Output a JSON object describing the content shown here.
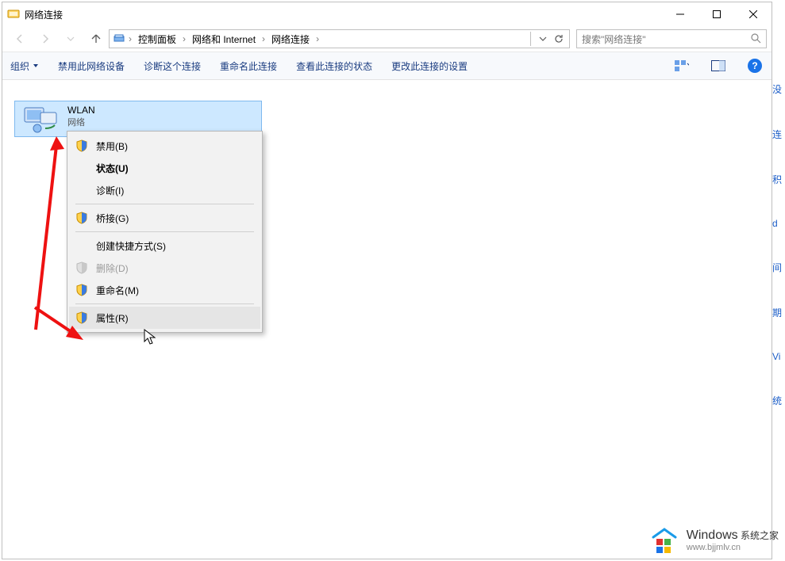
{
  "titlebar": {
    "title": "网络连接"
  },
  "breadcrumbs": {
    "b0": "控制面板",
    "b1": "网络和 Internet",
    "b2": "网络连接"
  },
  "search": {
    "placeholder": "搜索\"网络连接\""
  },
  "toolbar": {
    "org_label": "组织",
    "t1": "禁用此网络设备",
    "t2": "诊断这个连接",
    "t3": "重命名此连接",
    "t4": "查看此连接的状态",
    "t5": "更改此连接的设置"
  },
  "adapter": {
    "name": "WLAN",
    "sub": "网络"
  },
  "ctx": {
    "disable": "禁用(B)",
    "status": "状态(U)",
    "diagnose": "诊断(I)",
    "bridge": "桥接(G)",
    "shortcut": "创建快捷方式(S)",
    "delete": "删除(D)",
    "rename": "重命名(M)",
    "properties": "属性(R)"
  },
  "watermark": {
    "brand": "Windows",
    "suffix": " 系统之家",
    "url": "www.bjjmlv.cn"
  },
  "side": {
    "c1": "没",
    "c2": "连",
    "c3": "积",
    "c4": "d",
    "c5": "间",
    "c6": "期",
    "c7": "Vi",
    "c8": "统"
  }
}
